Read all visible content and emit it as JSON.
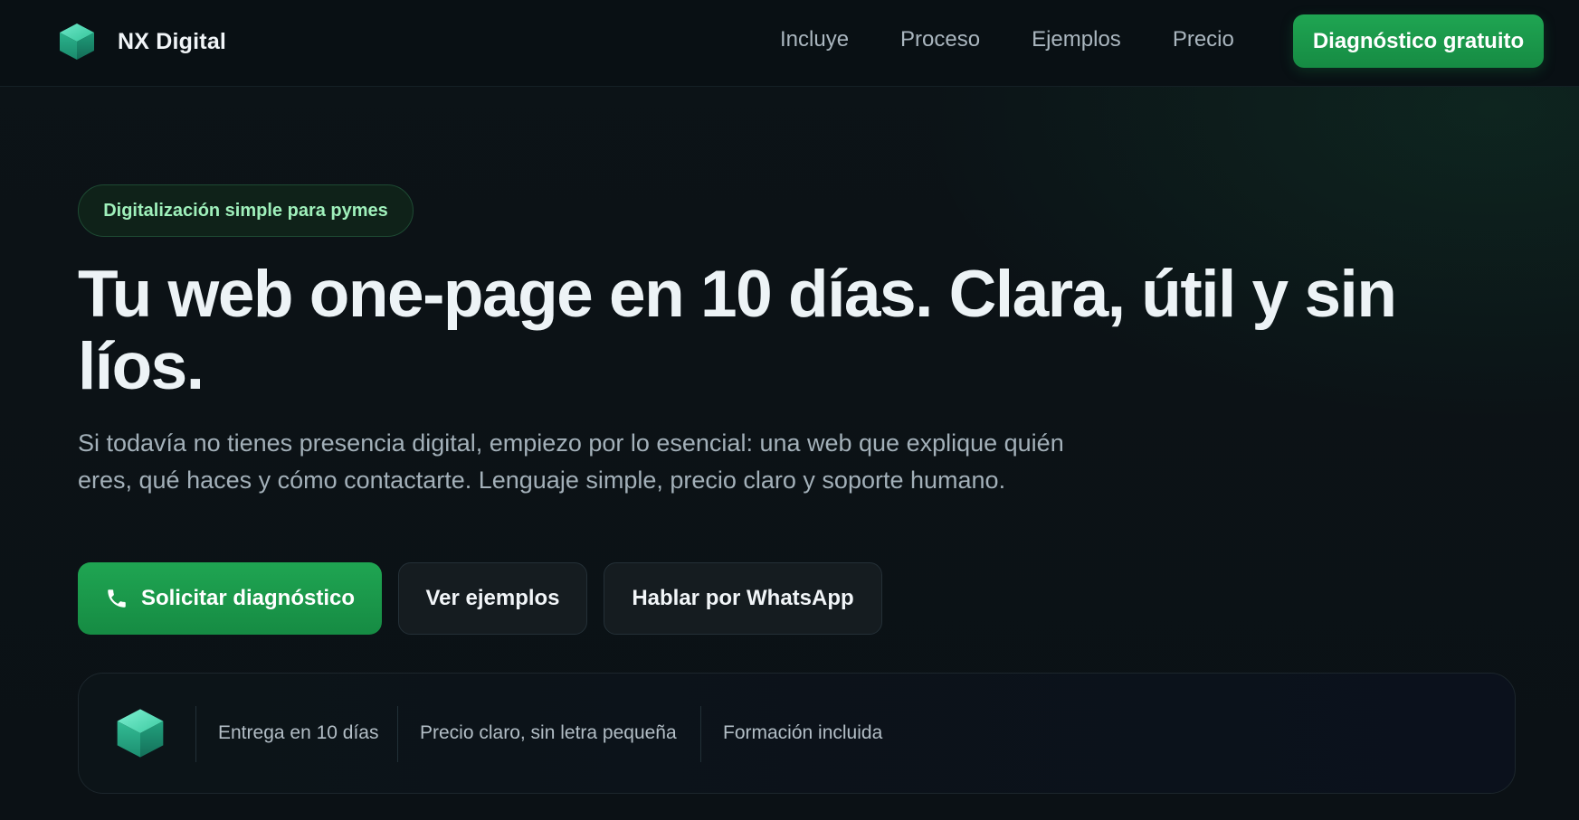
{
  "header": {
    "brand_name": "NX Digital",
    "brand_icon": "cube-logo-icon",
    "nav": [
      {
        "label": "Incluye"
      },
      {
        "label": "Proceso"
      },
      {
        "label": "Ejemplos"
      },
      {
        "label": "Precio"
      }
    ],
    "cta_label": "Diagnóstico gratuito"
  },
  "hero": {
    "pill": "Digitalización simple para pymes",
    "headline": "Tu web one-page en 10 días. Clara, útil y sin líos.",
    "subtext": "Si todavía no tienes presencia digital, empiezo por lo esencial: una web que explique quién eres, qué haces y cómo contactarte. Lenguaje simple, precio claro y soporte humano.",
    "buttons": {
      "primary": "Solicitar diagnóstico",
      "primary_icon": "phone-icon",
      "examples": "Ver ejemplos",
      "whatsapp": "Hablar por WhatsApp"
    }
  },
  "features": {
    "items": [
      {
        "label": "Entrega en 10 días"
      },
      {
        "label": "Precio claro, sin letra pequeña"
      },
      {
        "label": "Formación incluida"
      }
    ]
  },
  "colors": {
    "background": "#0b1114",
    "accent_green": "#1fa552",
    "pill_text": "#9ff0bb",
    "headline": "#edf3f6",
    "muted_text": "#a3b0b9"
  }
}
